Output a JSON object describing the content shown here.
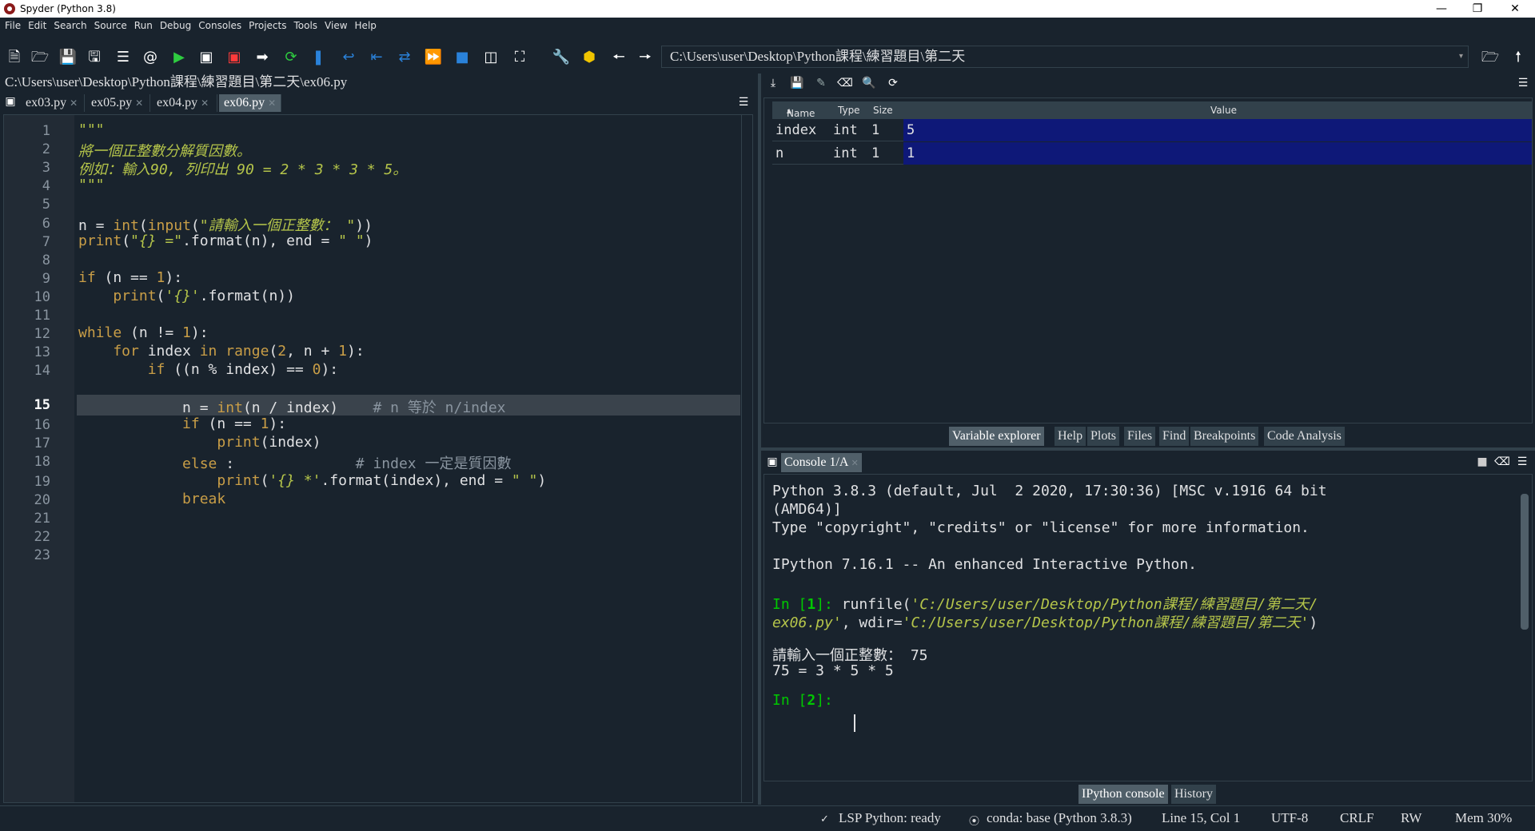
{
  "window": {
    "title": "Spyder (Python 3.8)"
  },
  "menu": [
    "File",
    "Edit",
    "Search",
    "Source",
    "Run",
    "Debug",
    "Consoles",
    "Projects",
    "Tools",
    "View",
    "Help"
  ],
  "toolbar": {
    "path": "C:\\Users\\user\\Desktop\\Python課程\\練習題目\\第二天"
  },
  "editor": {
    "filepath": "C:\\Users\\user\\Desktop\\Python課程\\練習題目\\第二天\\ex06.py",
    "tabs": [
      "ex03.py",
      "ex05.py",
      "ex04.py",
      "ex06.py"
    ],
    "active_tab": "ex06.py",
    "line_numbers": [
      "1",
      "2",
      "3",
      "4",
      "5",
      "6",
      "7",
      "8",
      "9",
      "10",
      "11",
      "12",
      "13",
      "14",
      "15",
      "16",
      "17",
      "18",
      "19",
      "20",
      "21",
      "22",
      "23"
    ],
    "current_line": "15",
    "code": {
      "l1": "\"\"\"",
      "l2": "將一個正整數分解質因數。",
      "l3": "例如：輸入90, 列印出 90 = 2 * 3 * 3 * 5。",
      "l4": "\"\"\"",
      "l6_a": "n = ",
      "l6_b": "int",
      "l6_c": "(",
      "l6_d": "input",
      "l6_e": "(",
      "l6_f": "\"請輸入一個正整數： \"",
      "l6_g": "))",
      "l7_a": "print",
      "l7_b": "(",
      "l7_c": "\"{} =\"",
      "l7_d": ".format(n), end = ",
      "l7_e": "\" \"",
      "l7_f": ")",
      "l9_a": "if",
      "l9_b": " (n == ",
      "l9_c": "1",
      "l9_d": "):",
      "l10_a": "    print",
      "l10_b": "(",
      "l10_c": "'{}'",
      "l10_d": ".format(n))",
      "l12_a": "while",
      "l12_b": " (n != ",
      "l12_c": "1",
      "l12_d": "):",
      "l13_a": "    for",
      "l13_b": " index ",
      "l13_c": "in",
      "l13_d": " range",
      "l13_e": "(",
      "l13_f": "2",
      "l13_g": ", n + ",
      "l13_h": "1",
      "l13_i": "):",
      "l14_a": "        if",
      "l14_b": " ((n % index) == ",
      "l14_c": "0",
      "l14_d": "):",
      "l15_a": "            n = ",
      "l15_b": "int",
      "l15_c": "(n / index)    ",
      "l15_d": "# n 等於 n/index",
      "l16_a": "            if",
      "l16_b": " (n == ",
      "l16_c": "1",
      "l16_d": "):",
      "l17_a": "                print",
      "l17_b": "(index)",
      "l18_a": "            else",
      "l18_b": " :              ",
      "l18_c": "# index 一定是質因數",
      "l19_a": "                print",
      "l19_b": "(",
      "l19_c": "'{} *'",
      "l19_d": ".format(index), end = ",
      "l19_e": "\" \"",
      "l19_f": ")",
      "l20_a": "            break"
    }
  },
  "variable_explorer": {
    "headers": {
      "name": "Name",
      "type": "Type",
      "size": "Size",
      "value": "Value"
    },
    "rows": [
      {
        "name": "index",
        "type": "int",
        "size": "1",
        "value": "5"
      },
      {
        "name": "n",
        "type": "int",
        "size": "1",
        "value": "1"
      }
    ],
    "tabs": [
      "Variable explorer",
      "Help",
      "Plots",
      "Files",
      "Find",
      "Breakpoints",
      "Code Analysis"
    ]
  },
  "console": {
    "tab": "Console 1/A",
    "lines": {
      "c1": "Python 3.8.3 (default, Jul  2 2020, 17:30:36) [MSC v.1916 64 bit",
      "c2": "(AMD64)]",
      "c3": "Type \"copyright\", \"credits\" or \"license\" for more information.",
      "c4": "IPython 7.16.1 -- An enhanced Interactive Python.",
      "c5_prompt_a": "In [",
      "c5_num": "1",
      "c5_prompt_b": "]: ",
      "c5_cmd": "runfile(",
      "c5_str": "'C:/Users/user/Desktop/Python課程/練習題目/第二天/",
      "c6_str": "ex06.py'",
      "c6_mid": ", wdir=",
      "c6_str2": "'C:/Users/user/Desktop/Python課程/練習題目/第二天'",
      "c6_end": ")",
      "c7": "請輸入一個正整數： 75",
      "c8": "75 = 3 * 5 * 5",
      "c9_prompt_a": "In [",
      "c9_num": "2",
      "c9_prompt_b": "]: "
    },
    "bottom_tabs": [
      "IPython console",
      "History"
    ]
  },
  "status": {
    "lsp": "LSP Python: ready",
    "conda": "conda: base (Python 3.8.3)",
    "position": "Line 15, Col 1",
    "encoding": "UTF-8",
    "eol": "CRLF",
    "rw": "RW",
    "mem": "Mem 30%"
  }
}
